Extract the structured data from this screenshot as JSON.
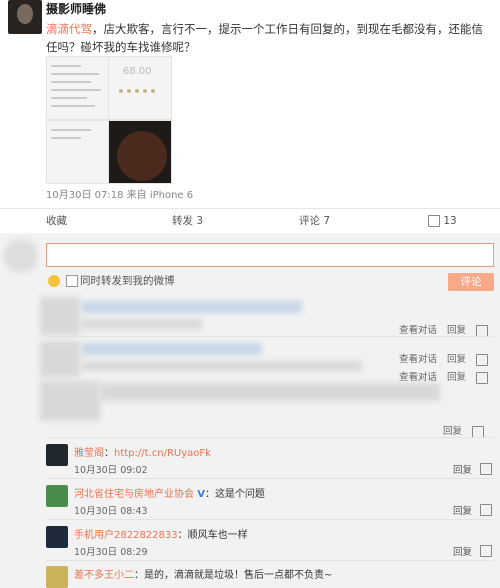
{
  "post": {
    "author": "摄影师睡佛",
    "mention": "滴滴代驾",
    "text": "，店大欺客，言行不一，提示一个工作日有回复的，到现在毛都没有，还能信任吗？碰坏我的车找谁修呢？",
    "thumbnail_percent": "68.00",
    "time": "10月30日 07:18",
    "source": "来自 iPhone 6"
  },
  "actions": {
    "favorite": "收藏",
    "repost": "转发 3",
    "comment": "评论 7",
    "like": "13"
  },
  "composer": {
    "placeholder": "",
    "repost_checkbox_label": "同时转发到我的微博",
    "submit_label": "评论"
  },
  "row_actions": {
    "view_thread": "查看对话",
    "reply": "回复"
  },
  "comments": [
    {
      "user": "雅莹阁",
      "sep": "：",
      "text": "http://t.cn/RUyaoFk",
      "time": "10月30日 09:02",
      "reply": "回复"
    },
    {
      "user": "河北省住宅与房地产业协会",
      "verified": "V",
      "sep": "：",
      "text": "这是个问题",
      "time": "10月30日 08:43",
      "reply": "回复"
    },
    {
      "user": "手机用户2822822833",
      "sep": "：",
      "text": "顺风车也一样",
      "time": "10月30日 08:29",
      "reply": "回复"
    },
    {
      "user": "差不多王小二",
      "sep": "：",
      "text": "是的，滴滴就是垃圾！售后一点都不负责~"
    }
  ],
  "colors": {
    "accent": "#eb7350",
    "submit": "#f7a988",
    "link": "#eb7350"
  }
}
